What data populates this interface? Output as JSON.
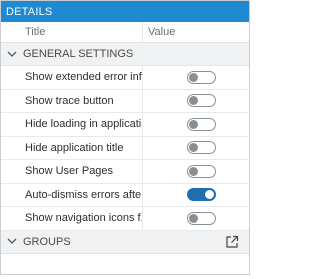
{
  "header": {
    "title": "DETAILS"
  },
  "columns": {
    "title": "Title",
    "value": "Value"
  },
  "sections": {
    "general": {
      "label": "GENERAL SETTINGS"
    },
    "groups": {
      "label": "GROUPS"
    }
  },
  "settings": [
    {
      "label": "Show extended error inf...",
      "on": false
    },
    {
      "label": "Show trace button",
      "on": false
    },
    {
      "label": "Hide loading in applicati...",
      "on": false
    },
    {
      "label": "Hide application title",
      "on": false
    },
    {
      "label": "Show User Pages",
      "on": false
    },
    {
      "label": "Auto-dismiss errors afte...",
      "on": true
    },
    {
      "label": "Show navigation icons f...",
      "on": false
    }
  ],
  "icons": {
    "chevron": "chevron-down-icon",
    "popout": "external-link-icon"
  },
  "colors": {
    "header_bg": "#1f8ad1",
    "toggle_on": "#1f6fb0",
    "toggle_off": "#8a8f94",
    "section_bg": "#f0f1f2"
  }
}
